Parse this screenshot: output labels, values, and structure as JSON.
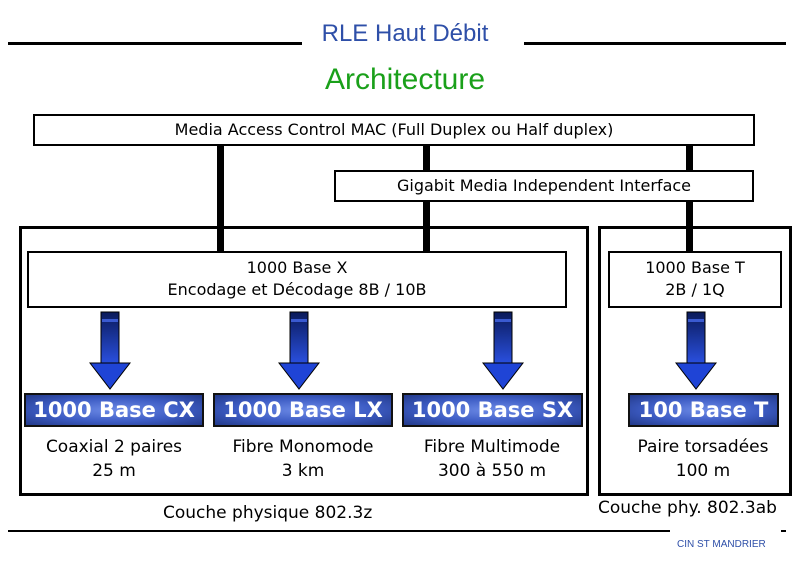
{
  "header": {
    "title": "RLE Haut Débit",
    "subtitle": "Architecture"
  },
  "layers": {
    "mac": "Media Access Control MAC (Full Duplex ou Half duplex)",
    "gmii": "Gigabit Media Independent Interface",
    "base_x": {
      "line1": "1000 Base X",
      "line2": "Encodage et Décodage 8B / 10B"
    },
    "base_t": {
      "line1": "1000 Base T",
      "line2": "2B / 1Q"
    }
  },
  "media": [
    {
      "label": "1000 Base CX",
      "desc1": "Coaxial 2 paires",
      "desc2": "25 m"
    },
    {
      "label": "1000 Base LX",
      "desc1": "Fibre Monomode",
      "desc2": "3 km"
    },
    {
      "label": "1000 Base SX",
      "desc1": "Fibre Multimode",
      "desc2": "300 à 550 m"
    },
    {
      "label": "100 Base T",
      "desc1": "Paire torsadées",
      "desc2": "100 m"
    }
  ],
  "footer": {
    "phys_x": "Couche physique 802.3z",
    "phys_t": "Couche phy. 802.3ab",
    "brand": "CIN ST MANDRIER"
  },
  "colors": {
    "title": "#2e4fa8",
    "subtitle": "#1aa01a",
    "arrow": "#1a3fc0",
    "media_box": "#3d5cc4"
  }
}
